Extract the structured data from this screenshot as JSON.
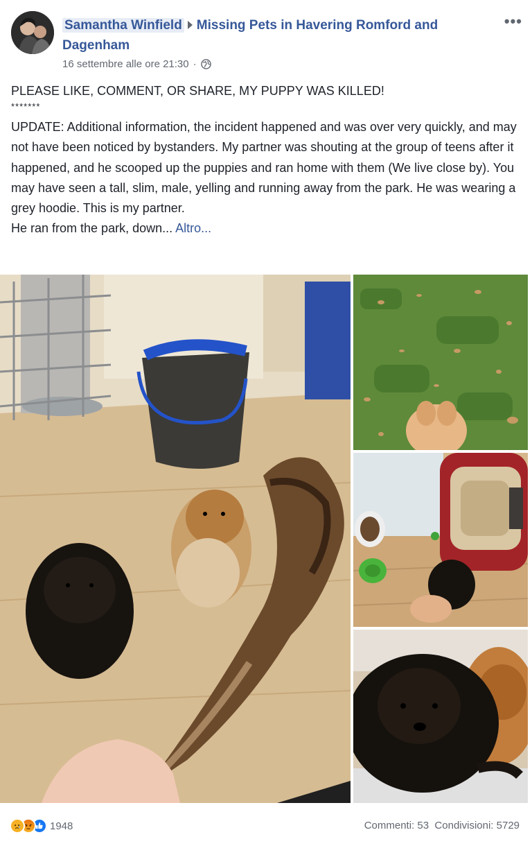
{
  "post": {
    "author": "Samantha Winfield",
    "group": "Missing Pets in Havering Romford and Dagenham",
    "timestamp": "16 settembre alle ore 21:30",
    "privacy_icon": "globe-icon",
    "more_icon": "•••",
    "text": {
      "headline": "PLEASE LIKE, COMMENT, OR SHARE, MY PUPPY WAS KILLED!",
      "stars": "*******",
      "update": "UPDATE: Additional information, the incident happened and was over very quickly, and may not have been noticed by bystanders. My partner was shouting at the group of teens after it happened, and he scooped up the puppies and ran home with them (We live close by). You may have seen a tall, slim, male, yelling and running away from the park. He was wearing a grey hoodie. This is my partner.",
      "last_line": "He ran from the park, down... ",
      "see_more": "Altro..."
    }
  },
  "footer": {
    "reaction_icons": [
      "sad-icon",
      "angry-icon",
      "like-icon"
    ],
    "reaction_count": "1948",
    "comments": "Commenti: 53",
    "shares": "Condivisioni: 5729"
  },
  "colors": {
    "link": "#365899",
    "text": "#1d2129",
    "meta": "#616770",
    "like": "#1877f2",
    "sad": "#f7b125",
    "angry": "#e9710f"
  }
}
